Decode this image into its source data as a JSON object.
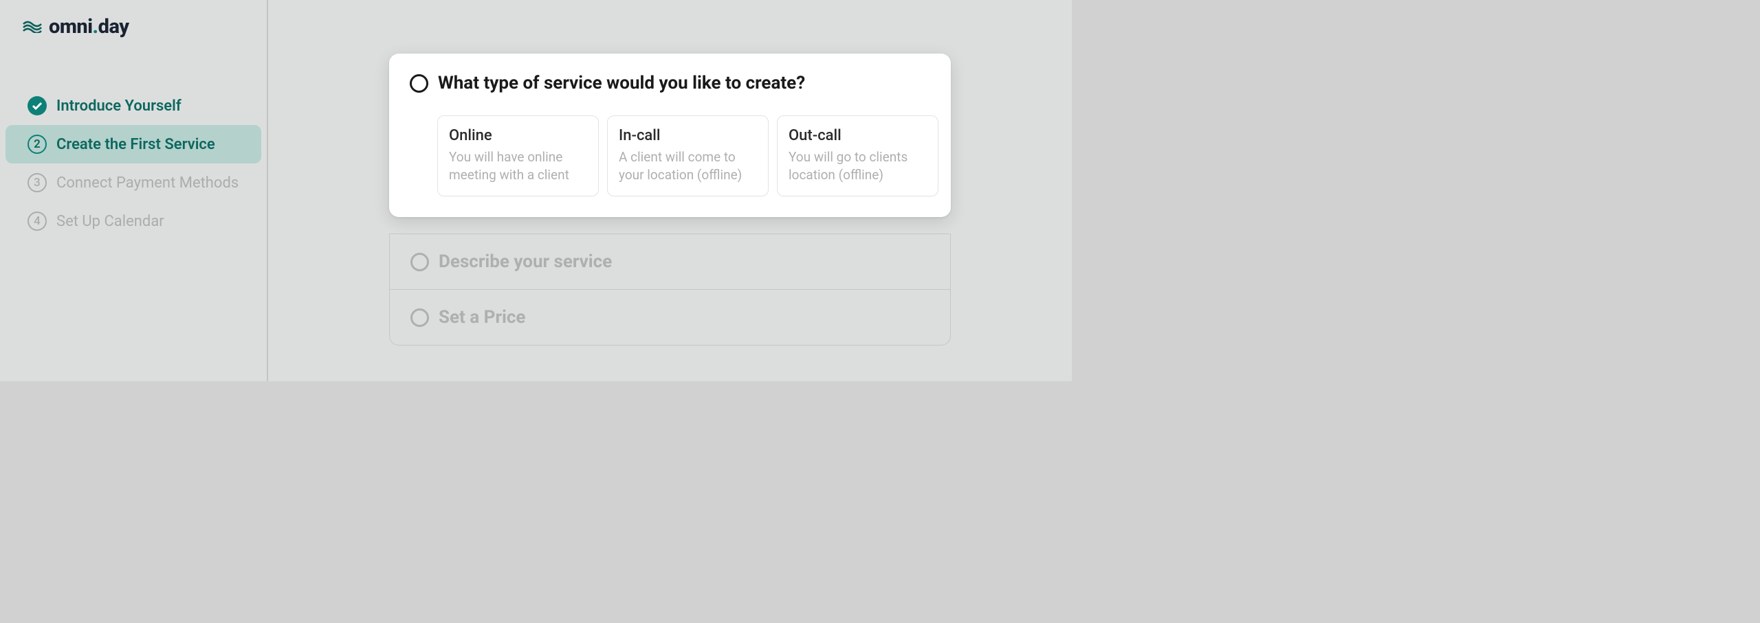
{
  "brand": {
    "name_part1": "omni",
    "name_part2": ".",
    "name_part3": "day"
  },
  "sidebar": {
    "steps": [
      {
        "label": "Introduce Yourself",
        "state": "completed"
      },
      {
        "label": "Create the First Service",
        "state": "active",
        "number": "2"
      },
      {
        "label": "Connect Payment Methods",
        "state": "pending",
        "number": "3"
      },
      {
        "label": "Set Up Calendar",
        "state": "pending",
        "number": "4"
      }
    ]
  },
  "main": {
    "active_section": {
      "title": "What type of service would you like to create?",
      "options": [
        {
          "title": "Online",
          "desc": "You will have online meeting with a client"
        },
        {
          "title": "In-call",
          "desc": "A client will come to your location (offline)"
        },
        {
          "title": "Out-call",
          "desc": "You will go to clients location (offline)"
        }
      ]
    },
    "collapsed_sections": [
      {
        "title": "Describe your service"
      },
      {
        "title": "Set a Price"
      }
    ]
  }
}
